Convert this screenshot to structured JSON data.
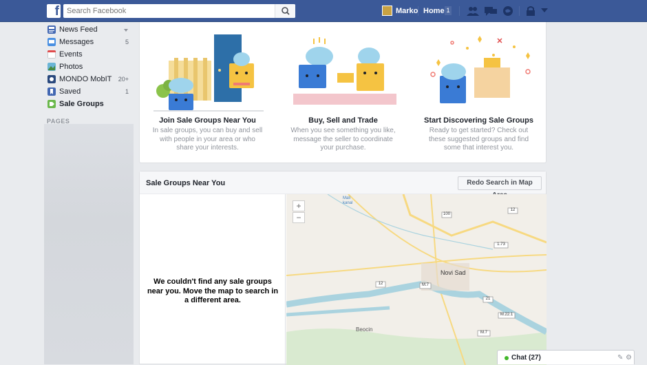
{
  "topbar": {
    "logo": "f",
    "search_placeholder": "Search Facebook",
    "user_name": "Marko",
    "home_label": "Home",
    "home_count": "1",
    "icons": [
      "friend-requests-icon",
      "messages-icon",
      "notifications-icon",
      "privacy-shortcuts-icon",
      "account-menu-icon"
    ]
  },
  "sidebar": {
    "items": [
      {
        "label": "News Feed",
        "count": "",
        "icon": "news-feed-icon"
      },
      {
        "label": "Messages",
        "count": "5",
        "icon": "messages-icon"
      },
      {
        "label": "Events",
        "count": "",
        "icon": "events-icon"
      },
      {
        "label": "Photos",
        "count": "",
        "icon": "photos-icon"
      },
      {
        "label": "MONDO MobIT",
        "count": "20+",
        "icon": "group-icon"
      },
      {
        "label": "Saved",
        "count": "1",
        "icon": "saved-icon"
      },
      {
        "label": "Sale Groups",
        "count": "",
        "icon": "sale-groups-icon"
      }
    ],
    "pages_title": "PAGES"
  },
  "intro": {
    "columns": [
      {
        "title": "Join Sale Groups Near You",
        "desc": "In sale groups, you can buy and sell with people in your area or who share your interests."
      },
      {
        "title": "Buy, Sell and Trade",
        "desc": "When you see something you like, message the seller to coordinate your purchase."
      },
      {
        "title": "Start Discovering Sale Groups",
        "desc": "Ready to get started? Check out these suggested groups and find some that interest you."
      }
    ]
  },
  "panel": {
    "title": "Sale Groups Near You",
    "redo_button": "Redo Search in Map Area",
    "empty_message": "We couldn't find any sale groups near you. Move the map to search in a different area."
  },
  "map": {
    "zoom_in": "+",
    "zoom_out": "−",
    "labels": {
      "city": "Novi Sad",
      "town": "Beocin",
      "canal": "Mali kanal"
    },
    "road_badges": [
      "100",
      "12",
      "1.73",
      "M.7",
      "12",
      "21",
      "M.22.1",
      "M.7"
    ],
    "colors": {
      "water": "#aad3df",
      "land": "#f2efe9",
      "road_major": "#f7d981",
      "green": "#d9ead0"
    }
  },
  "chat": {
    "label": "Chat (27)"
  },
  "colors": {
    "brand": "#3b5998",
    "background": "#e9ebee",
    "online": "#42b72a"
  }
}
